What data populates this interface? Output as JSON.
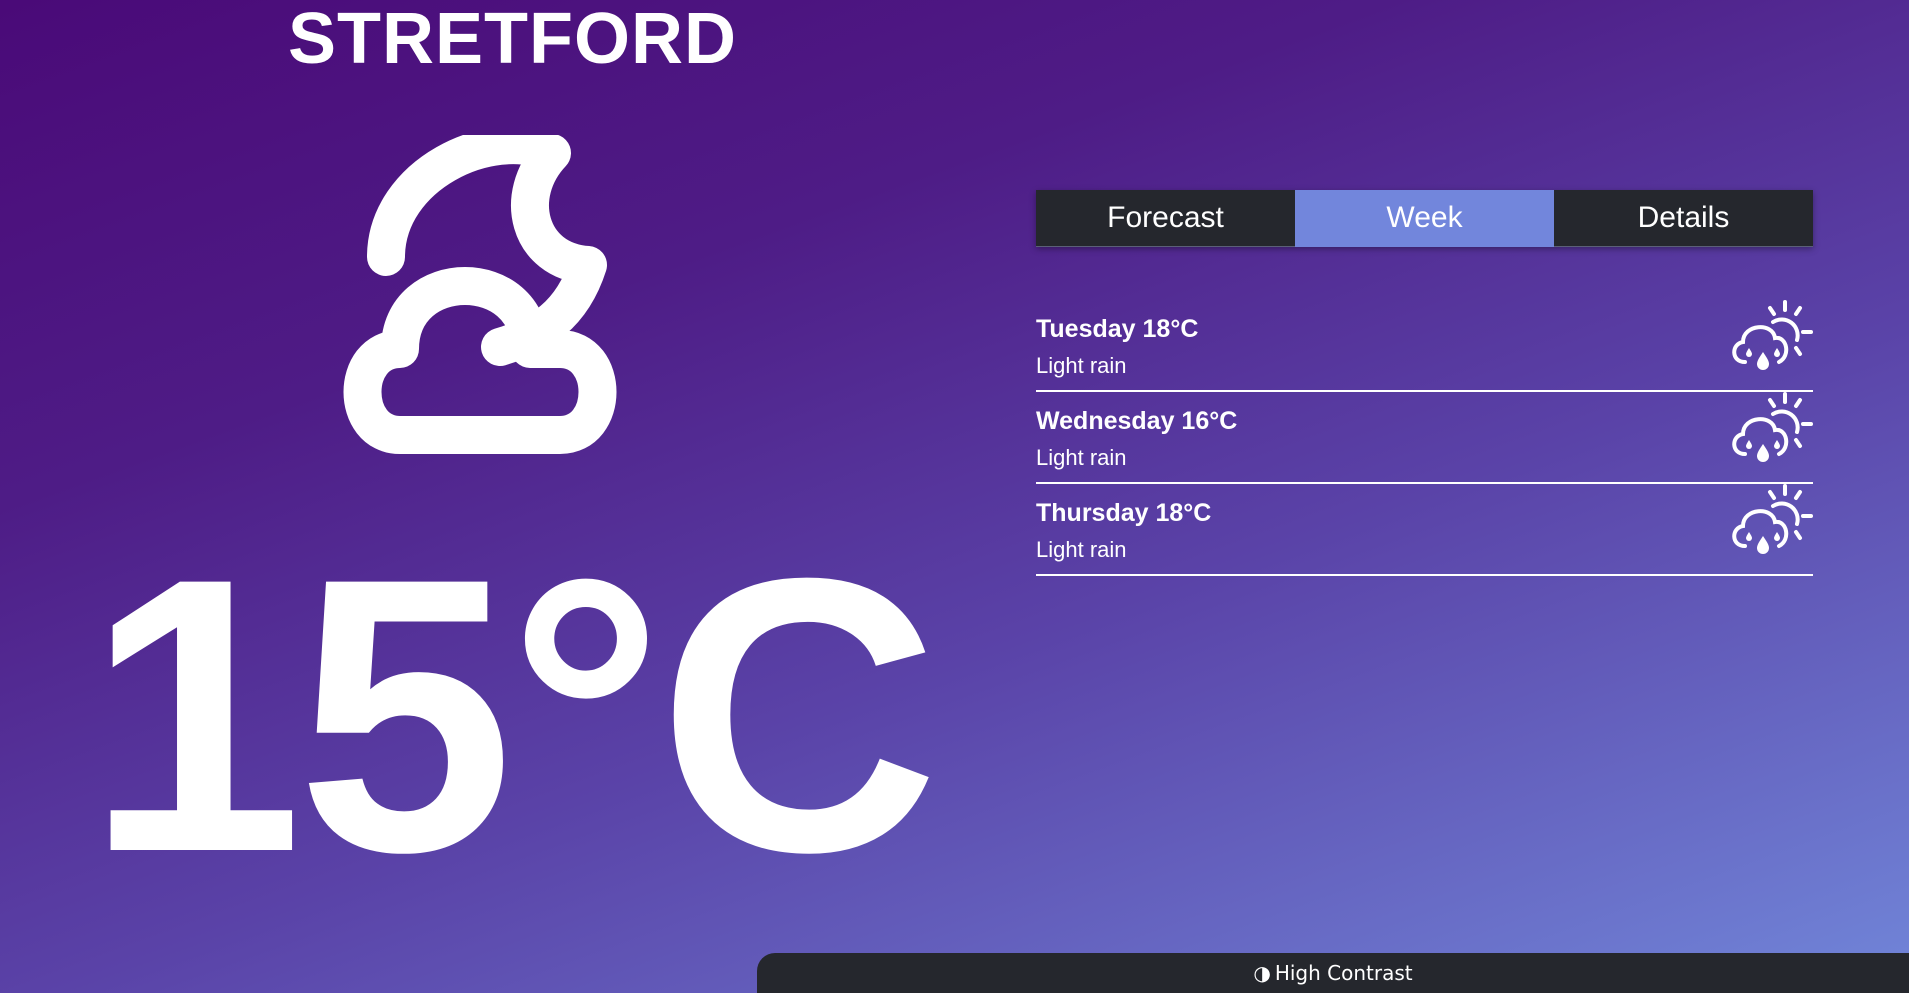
{
  "location": {
    "name": "STRETFORD"
  },
  "current": {
    "temperature": "15°C",
    "icon": "cloud-moon-icon"
  },
  "tabs": [
    {
      "label": "Forecast",
      "active": false
    },
    {
      "label": "Week",
      "active": true
    },
    {
      "label": "Details",
      "active": false
    }
  ],
  "week": [
    {
      "title": "Tuesday 18°C",
      "condition": "Light rain",
      "icon": "cloud-sun-rain-icon"
    },
    {
      "title": "Wednesday 16°C",
      "condition": "Light rain",
      "icon": "cloud-sun-rain-icon"
    },
    {
      "title": "Thursday 18°C",
      "condition": "Light rain",
      "icon": "cloud-sun-rain-icon"
    }
  ],
  "footer": {
    "high_contrast_icon": "◑",
    "high_contrast_label": "High Contrast"
  },
  "colors": {
    "background_top": "#4a0a78",
    "background_bottom": "#7186d9",
    "tab_bg": "#25272d",
    "tab_active_bg": "#7286dc"
  }
}
